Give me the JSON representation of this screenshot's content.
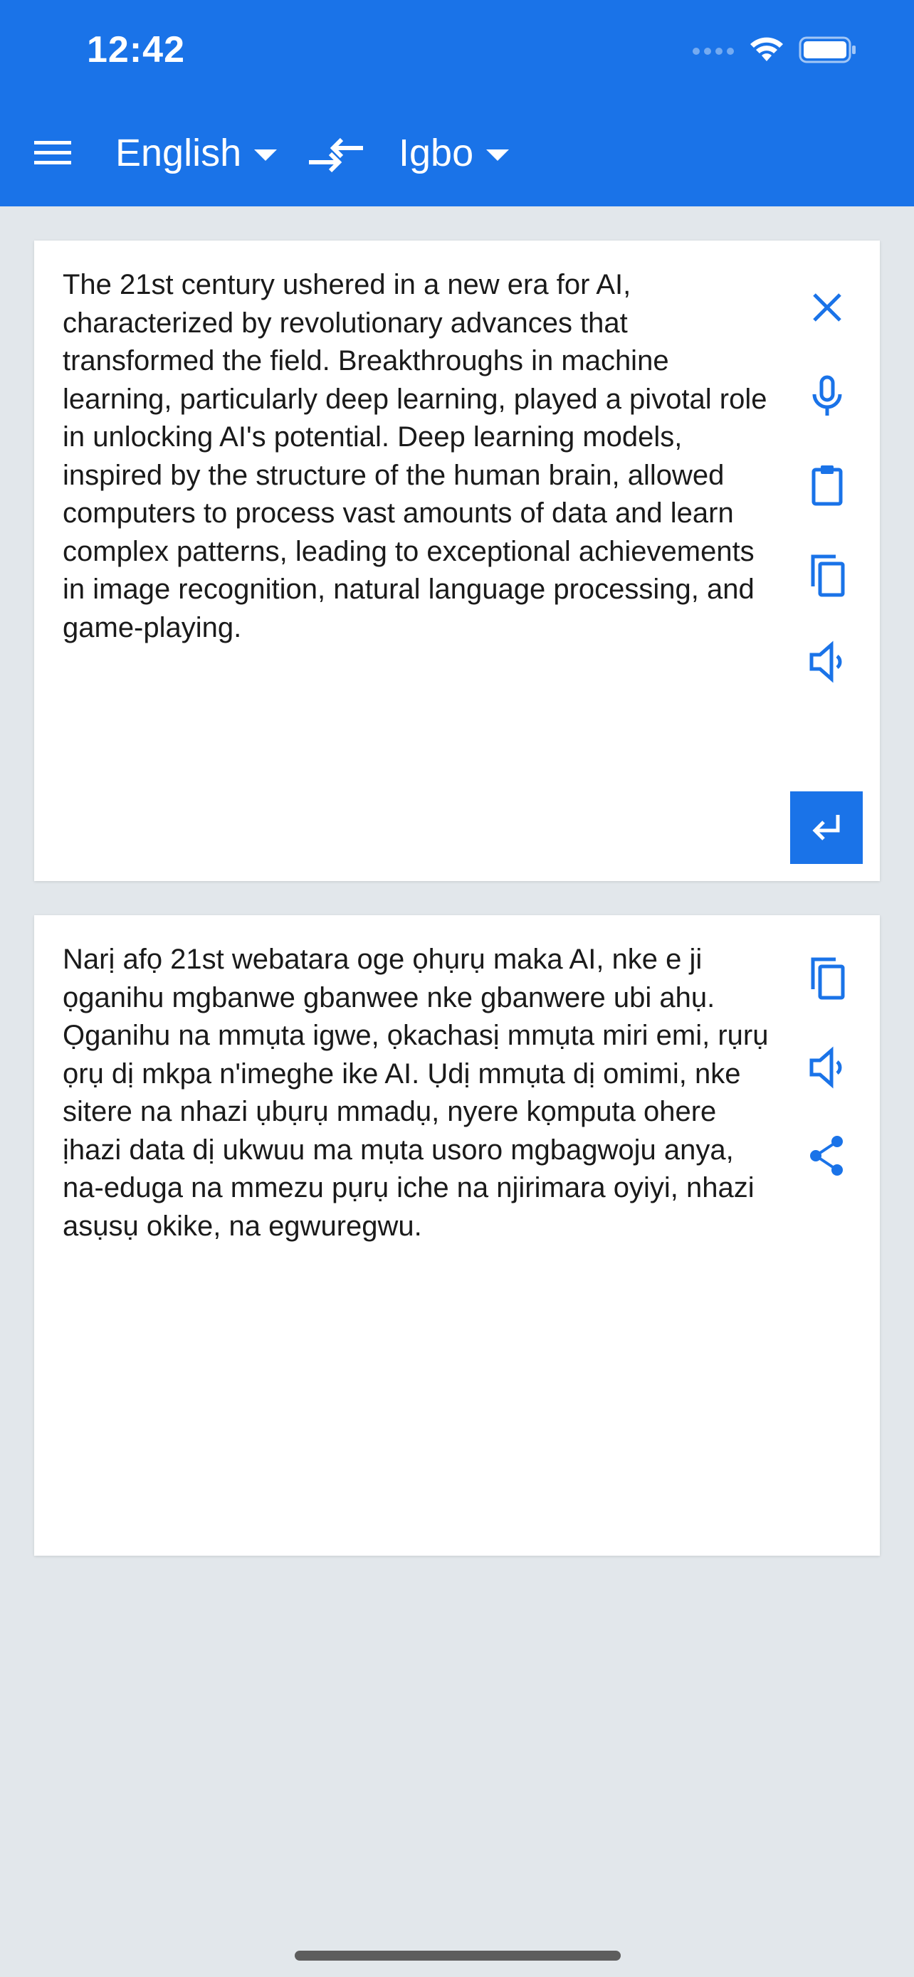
{
  "status_bar": {
    "time": "12:42"
  },
  "toolbar": {
    "menu_icon": "hamburger-menu-icon",
    "source_language": "English",
    "target_language": "Igbo",
    "swap_icon": "swap-arrows-icon",
    "caret_icon": "caret-down-icon"
  },
  "source_card": {
    "text": "The 21st century ushered in a new era for AI, characterized by revolutionary advances that transformed the field. Breakthroughs in machine learning, particularly deep learning, played a pivotal role in unlocking AI's potential. Deep learning models, inspired by the structure of the human brain, allowed computers to process vast amounts of data and learn complex patterns, leading to exceptional achievements in image recognition, natural language processing, and game-playing.",
    "icons": [
      "close-icon",
      "microphone-icon",
      "clipboard-icon",
      "copy-icon",
      "speaker-icon",
      "enter-icon"
    ]
  },
  "target_card": {
    "text": "Narị afọ 21st webatara oge ọhụrụ maka AI, nke e ji ọganihu mgbanwe gbanwee nke gbanwere ubi ahụ. Ọganihu na mmụta igwe, ọkachasị mmụta miri emi, rụrụ ọrụ dị mkpa n'imeghe ike AI. Ụdị mmụta dị omimi, nke sitere na nhazi ụbụrụ mmadụ, nyere kọmputa ohere ịhazi data dị ukwuu ma mụta usoro mgbagwoju anya, na-eduga na mmezu pụrụ iche na njirimara oyiyi, nhazi asụsụ okike, na egwuregwu.",
    "icons": [
      "copy-icon",
      "speaker-icon",
      "share-icon"
    ]
  },
  "colors": {
    "accent": "#1a73e8",
    "background": "#e2e7eb",
    "card": "#ffffff",
    "text": "#1a1a1a"
  }
}
